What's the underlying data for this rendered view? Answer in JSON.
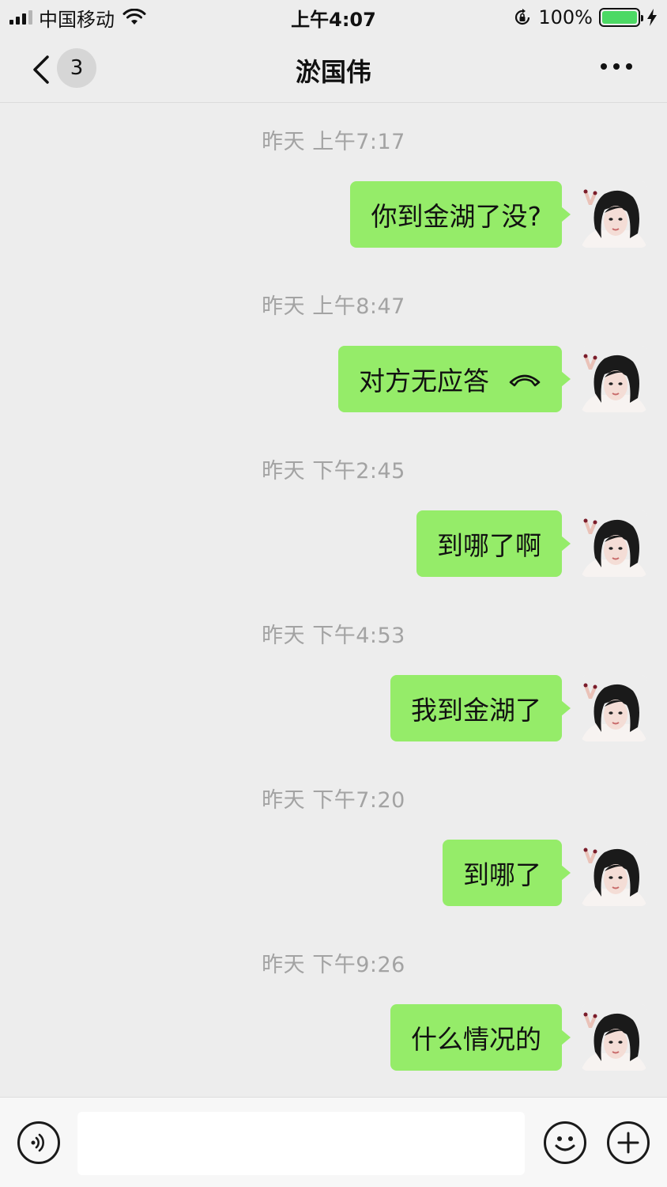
{
  "status_bar": {
    "carrier": "中国移动",
    "time": "上午4:07",
    "battery_percent": "100%",
    "battery_level": 1.0,
    "battery_color": "#4cd964"
  },
  "nav": {
    "back_icon": "chevron-left-icon",
    "unread_count": "3",
    "title": "淤国伟",
    "more_icon": "more-dots-icon"
  },
  "theme": {
    "bubble_color": "#95ec69",
    "background": "#ededed",
    "timestamp_color": "#a3a3a3"
  },
  "messages": [
    {
      "timestamp": "昨天 上午7:17",
      "text": "你到金湖了没?",
      "direction": "outgoing"
    },
    {
      "timestamp": "昨天 上午8:47",
      "text": "对方无应答",
      "direction": "outgoing",
      "type": "call",
      "icon": "phone-hangup-icon"
    },
    {
      "timestamp": "昨天 下午2:45",
      "text": "到哪了啊",
      "direction": "outgoing"
    },
    {
      "timestamp": "昨天 下午4:53",
      "text": "我到金湖了",
      "direction": "outgoing"
    },
    {
      "timestamp": "昨天 下午7:20",
      "text": "到哪了",
      "direction": "outgoing"
    },
    {
      "timestamp": "昨天 下午9:26",
      "text": "什么情况的",
      "direction": "outgoing"
    }
  ],
  "input_bar": {
    "voice_icon": "voice-icon",
    "input_value": "",
    "emoji_icon": "emoji-icon",
    "plus_icon": "plus-icon"
  }
}
